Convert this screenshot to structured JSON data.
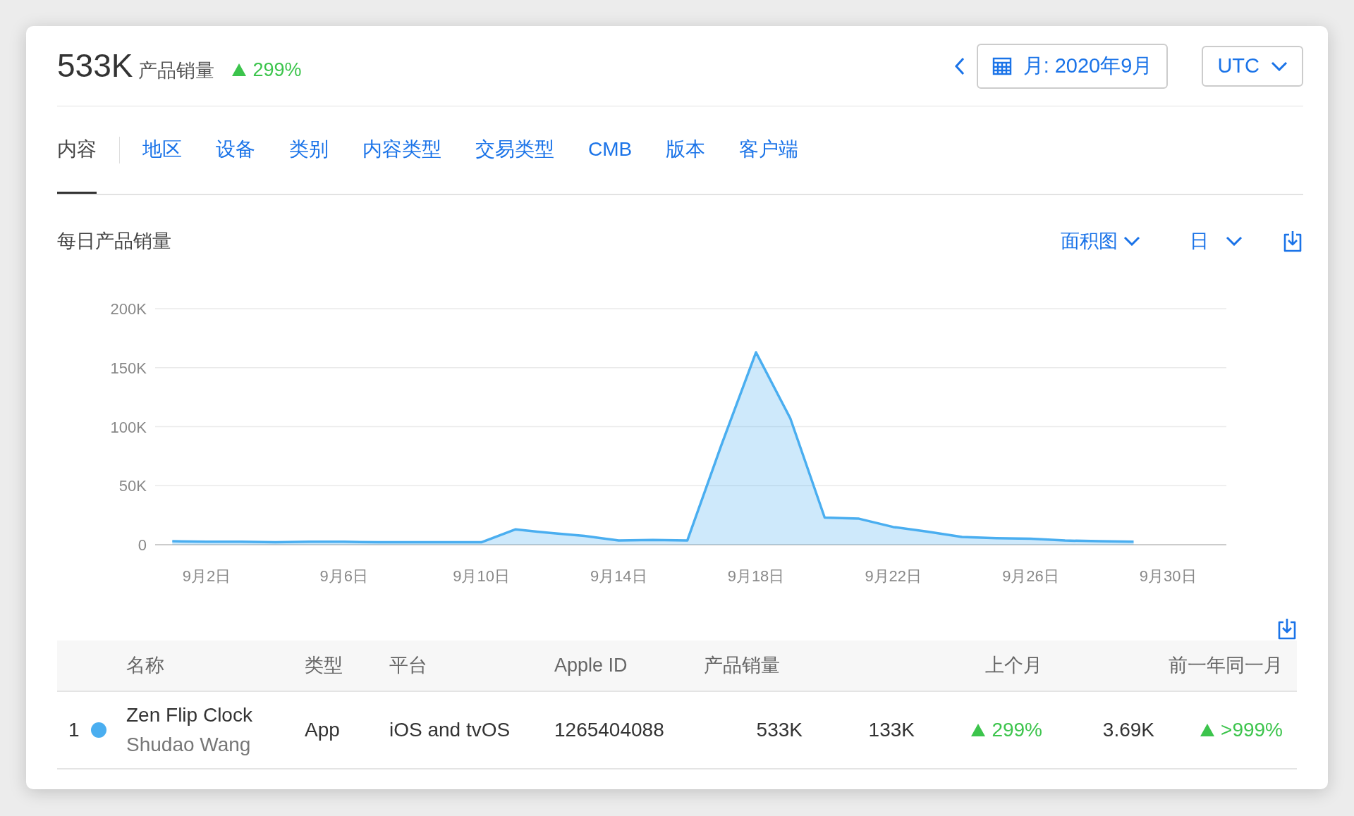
{
  "summary": {
    "value": "533K",
    "label": "产品销量",
    "change": "299%",
    "increase": true
  },
  "period": {
    "label": "月: 2020年9月"
  },
  "timezone": {
    "label": "UTC"
  },
  "tabs": [
    {
      "label": "内容",
      "selected": true
    },
    {
      "label": "地区",
      "selected": false
    },
    {
      "label": "设备",
      "selected": false
    },
    {
      "label": "类别",
      "selected": false
    },
    {
      "label": "内容类型",
      "selected": false
    },
    {
      "label": "交易类型",
      "selected": false
    },
    {
      "label": "CMB",
      "selected": false
    },
    {
      "label": "版本",
      "selected": false
    },
    {
      "label": "客户端",
      "selected": false
    }
  ],
  "chart_section": {
    "title": "每日产品销量",
    "chart_type": "面积图",
    "interval": "日",
    "chart_data": {
      "type": "area",
      "categories": [
        null,
        "9月2日",
        null,
        null,
        null,
        "9月6日",
        null,
        null,
        null,
        "9月10日",
        null,
        null,
        null,
        "9月14日",
        null,
        null,
        null,
        "9月18日",
        null,
        null,
        null,
        "9月22日",
        null,
        null,
        null,
        "9月26日",
        null,
        null,
        null,
        "9月30日"
      ],
      "series": [
        {
          "color": "#4aaef0",
          "values": [
            3000,
            2500,
            2500,
            2000,
            2500,
            2500,
            2000,
            2000,
            2000,
            2000,
            13000,
            10000,
            7500,
            3500,
            4000,
            3500,
            85000,
            163000,
            107000,
            23000,
            22000,
            15000,
            11000,
            6500,
            5500,
            5000,
            3500,
            3000,
            2500,
            null
          ]
        }
      ],
      "ylim": [
        0,
        200000
      ],
      "grid": true,
      "yticks": [
        {
          "value": 0,
          "label": "0"
        },
        {
          "value": 50000,
          "label": "50K"
        },
        {
          "value": 100000,
          "label": "100K"
        },
        {
          "value": 150000,
          "label": "150K"
        },
        {
          "value": 200000,
          "label": "200K"
        }
      ]
    }
  },
  "table": {
    "columns": [
      "名称",
      "类型",
      "平台",
      "Apple ID",
      "产品销量",
      "上个月",
      "前一年同一月"
    ],
    "rows": [
      {
        "rank": "1",
        "color": "#4aaef0",
        "name": "Zen Flip Clock",
        "developer": "Shudao Wang",
        "type": "App",
        "platform": "iOS and tvOS",
        "apple_id": "1265404088",
        "sales": "533K",
        "last_month": "133K",
        "last_month_change": "299%",
        "last_month_increase": true,
        "last_year": "3.69K",
        "last_year_change": ">999%",
        "last_year_increase": true
      }
    ]
  }
}
